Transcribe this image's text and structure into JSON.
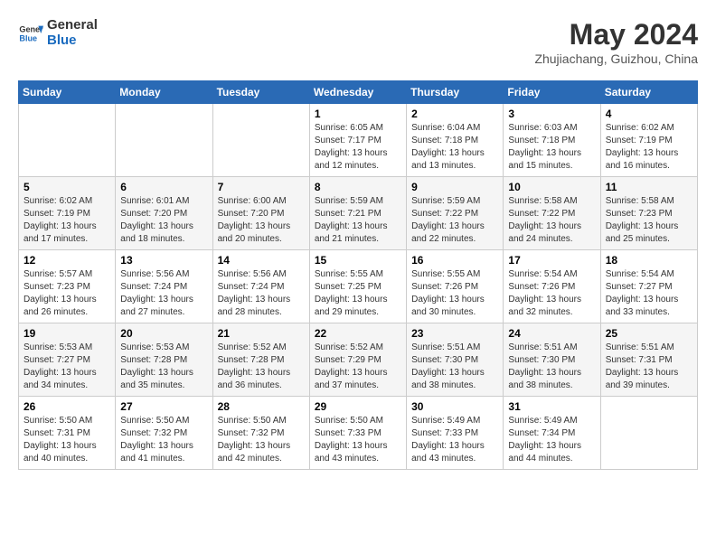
{
  "header": {
    "logo_line1": "General",
    "logo_line2": "Blue",
    "month_year": "May 2024",
    "location": "Zhujiachang, Guizhou, China"
  },
  "days_of_week": [
    "Sunday",
    "Monday",
    "Tuesday",
    "Wednesday",
    "Thursday",
    "Friday",
    "Saturday"
  ],
  "weeks": [
    [
      {
        "day": "",
        "info": ""
      },
      {
        "day": "",
        "info": ""
      },
      {
        "day": "",
        "info": ""
      },
      {
        "day": "1",
        "info": "Sunrise: 6:05 AM\nSunset: 7:17 PM\nDaylight: 13 hours and 12 minutes."
      },
      {
        "day": "2",
        "info": "Sunrise: 6:04 AM\nSunset: 7:18 PM\nDaylight: 13 hours and 13 minutes."
      },
      {
        "day": "3",
        "info": "Sunrise: 6:03 AM\nSunset: 7:18 PM\nDaylight: 13 hours and 15 minutes."
      },
      {
        "day": "4",
        "info": "Sunrise: 6:02 AM\nSunset: 7:19 PM\nDaylight: 13 hours and 16 minutes."
      }
    ],
    [
      {
        "day": "5",
        "info": "Sunrise: 6:02 AM\nSunset: 7:19 PM\nDaylight: 13 hours and 17 minutes."
      },
      {
        "day": "6",
        "info": "Sunrise: 6:01 AM\nSunset: 7:20 PM\nDaylight: 13 hours and 18 minutes."
      },
      {
        "day": "7",
        "info": "Sunrise: 6:00 AM\nSunset: 7:20 PM\nDaylight: 13 hours and 20 minutes."
      },
      {
        "day": "8",
        "info": "Sunrise: 5:59 AM\nSunset: 7:21 PM\nDaylight: 13 hours and 21 minutes."
      },
      {
        "day": "9",
        "info": "Sunrise: 5:59 AM\nSunset: 7:22 PM\nDaylight: 13 hours and 22 minutes."
      },
      {
        "day": "10",
        "info": "Sunrise: 5:58 AM\nSunset: 7:22 PM\nDaylight: 13 hours and 24 minutes."
      },
      {
        "day": "11",
        "info": "Sunrise: 5:58 AM\nSunset: 7:23 PM\nDaylight: 13 hours and 25 minutes."
      }
    ],
    [
      {
        "day": "12",
        "info": "Sunrise: 5:57 AM\nSunset: 7:23 PM\nDaylight: 13 hours and 26 minutes."
      },
      {
        "day": "13",
        "info": "Sunrise: 5:56 AM\nSunset: 7:24 PM\nDaylight: 13 hours and 27 minutes."
      },
      {
        "day": "14",
        "info": "Sunrise: 5:56 AM\nSunset: 7:24 PM\nDaylight: 13 hours and 28 minutes."
      },
      {
        "day": "15",
        "info": "Sunrise: 5:55 AM\nSunset: 7:25 PM\nDaylight: 13 hours and 29 minutes."
      },
      {
        "day": "16",
        "info": "Sunrise: 5:55 AM\nSunset: 7:26 PM\nDaylight: 13 hours and 30 minutes."
      },
      {
        "day": "17",
        "info": "Sunrise: 5:54 AM\nSunset: 7:26 PM\nDaylight: 13 hours and 32 minutes."
      },
      {
        "day": "18",
        "info": "Sunrise: 5:54 AM\nSunset: 7:27 PM\nDaylight: 13 hours and 33 minutes."
      }
    ],
    [
      {
        "day": "19",
        "info": "Sunrise: 5:53 AM\nSunset: 7:27 PM\nDaylight: 13 hours and 34 minutes."
      },
      {
        "day": "20",
        "info": "Sunrise: 5:53 AM\nSunset: 7:28 PM\nDaylight: 13 hours and 35 minutes."
      },
      {
        "day": "21",
        "info": "Sunrise: 5:52 AM\nSunset: 7:28 PM\nDaylight: 13 hours and 36 minutes."
      },
      {
        "day": "22",
        "info": "Sunrise: 5:52 AM\nSunset: 7:29 PM\nDaylight: 13 hours and 37 minutes."
      },
      {
        "day": "23",
        "info": "Sunrise: 5:51 AM\nSunset: 7:30 PM\nDaylight: 13 hours and 38 minutes."
      },
      {
        "day": "24",
        "info": "Sunrise: 5:51 AM\nSunset: 7:30 PM\nDaylight: 13 hours and 38 minutes."
      },
      {
        "day": "25",
        "info": "Sunrise: 5:51 AM\nSunset: 7:31 PM\nDaylight: 13 hours and 39 minutes."
      }
    ],
    [
      {
        "day": "26",
        "info": "Sunrise: 5:50 AM\nSunset: 7:31 PM\nDaylight: 13 hours and 40 minutes."
      },
      {
        "day": "27",
        "info": "Sunrise: 5:50 AM\nSunset: 7:32 PM\nDaylight: 13 hours and 41 minutes."
      },
      {
        "day": "28",
        "info": "Sunrise: 5:50 AM\nSunset: 7:32 PM\nDaylight: 13 hours and 42 minutes."
      },
      {
        "day": "29",
        "info": "Sunrise: 5:50 AM\nSunset: 7:33 PM\nDaylight: 13 hours and 43 minutes."
      },
      {
        "day": "30",
        "info": "Sunrise: 5:49 AM\nSunset: 7:33 PM\nDaylight: 13 hours and 43 minutes."
      },
      {
        "day": "31",
        "info": "Sunrise: 5:49 AM\nSunset: 7:34 PM\nDaylight: 13 hours and 44 minutes."
      },
      {
        "day": "",
        "info": ""
      }
    ]
  ]
}
